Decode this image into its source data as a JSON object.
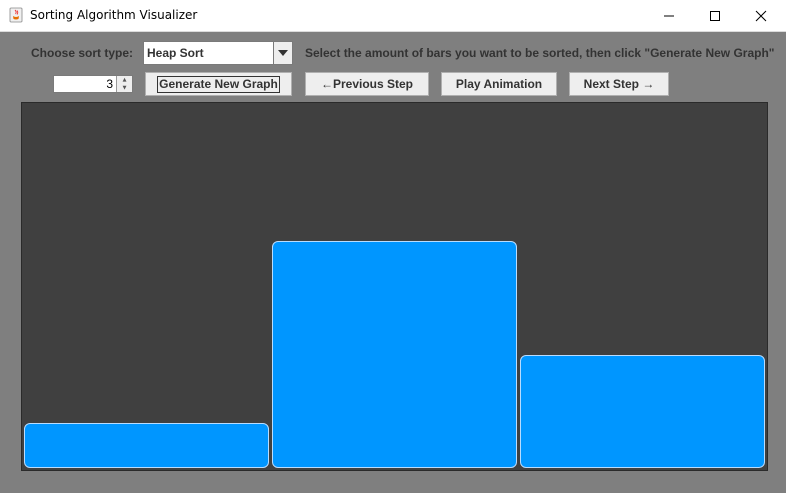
{
  "window": {
    "title": "Sorting Algorithm Visualizer"
  },
  "controls": {
    "sort_type_label": "Choose sort type:",
    "sort_type_value": "Heap Sort",
    "instructions": "Select the amount of bars you want to be sorted, then click \"Generate New Graph\"",
    "bar_count": "3",
    "generate_label": "Generate New Graph",
    "previous_label": "←Previous Step",
    "play_label": "Play Animation",
    "next_label": "Next Step →"
  },
  "graph": {
    "bar_color": "#0096ff",
    "background": "#404040",
    "max_value": 10,
    "bars": [
      {
        "value": 2
      },
      {
        "value": 10
      },
      {
        "value": 5
      }
    ]
  }
}
